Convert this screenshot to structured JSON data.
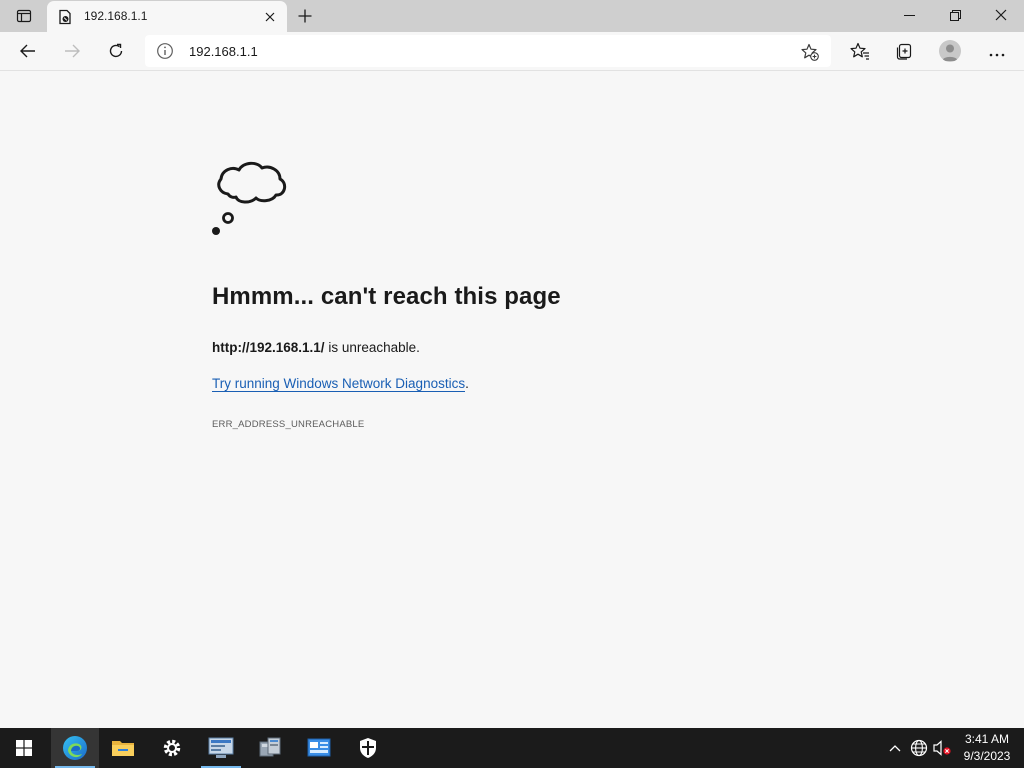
{
  "browser": {
    "tab_title": "192.168.1.1",
    "address": "192.168.1.1"
  },
  "error_page": {
    "heading": "Hmmm... can't reach this page",
    "url": "http://192.168.1.1/",
    "message_suffix": " is unreachable.",
    "diagnostics_link": "Try running Windows Network Diagnostics",
    "diagnostics_suffix": ".",
    "error_code": "ERR_ADDRESS_UNREACHABLE"
  },
  "taskbar": {
    "apps": [
      "start-icon",
      "edge-icon",
      "file-explorer-icon",
      "settings-icon",
      "server-manager-icon",
      "network-icon",
      "control-panel-icon",
      "security-icon"
    ],
    "clock_time": "3:41 AM",
    "clock_date": "9/3/2023"
  },
  "colors": {
    "link": "#1a5fb4",
    "taskbar": "#1b1b1b",
    "accent": "#76b9ed"
  }
}
